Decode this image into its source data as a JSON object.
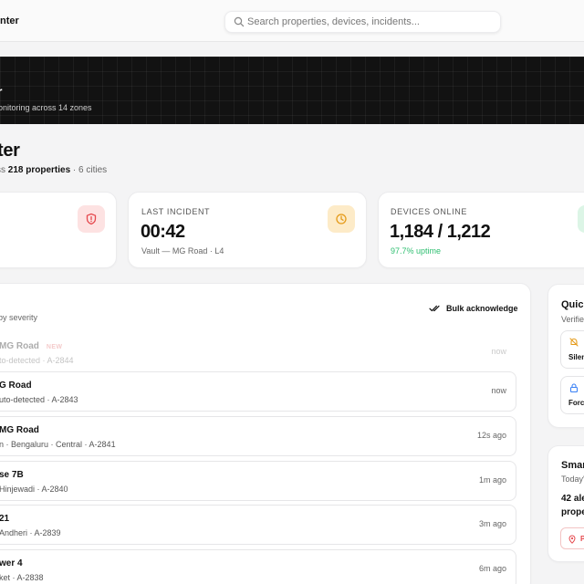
{
  "topbar": {
    "brand": "nter",
    "search_placeholder": "Search properties, devices, incidents..."
  },
  "hero": {
    "title": "r",
    "subtitle": "onitoring across 14 zones"
  },
  "page": {
    "title": "ter",
    "subtitle_prefix": "ss ",
    "subtitle_bold": "218 properties",
    "subtitle_suffix": " · 6 cities"
  },
  "stats": [
    {
      "label": "",
      "value": "",
      "foot": "",
      "icon": "shield-alert-icon",
      "accent": "#e5484d",
      "accent_bg": "#fde2e2"
    },
    {
      "label": "LAST INCIDENT",
      "value": "00:42",
      "foot": "Vault — MG Road · L4",
      "icon": "clock-icon",
      "accent": "#e59b1a",
      "accent_bg": "#fdebc8"
    },
    {
      "label": "DEVICES ONLINE",
      "value": "1,184 / 1,212",
      "foot": "97.7% uptime",
      "icon": "device-icon",
      "accent": "#2fbf71",
      "accent_bg": "#dcf5e6"
    }
  ],
  "incidents_panel": {
    "subtitle": "by severity",
    "bulk_label": "Bulk acknowledge",
    "new_badge": "NEW",
    "items": [
      {
        "title": "MG Road",
        "sub": "to-detected · A-2844",
        "time": "now",
        "is_new": true
      },
      {
        "title": "G Road",
        "sub": "uto-detected · A-2843",
        "time": "now"
      },
      {
        "title": "MG Road",
        "sub": "n · Bengaluru · Central · A-2841",
        "time": "12s ago"
      },
      {
        "title": "se 7B",
        "sub": "Hinjewadi · A-2840",
        "time": "1m ago"
      },
      {
        "title": "21",
        "sub": "Andheri · A-2839",
        "time": "3m ago"
      },
      {
        "title": "wer 4",
        "sub": "ket · A-2838",
        "time": "6m ago"
      }
    ]
  },
  "quick": {
    "title": "Quick",
    "subtitle": "Verifie",
    "buttons": [
      {
        "label": "Silen",
        "icon": "bell-off-icon",
        "color": "#e59b1a"
      },
      {
        "label": "Forc",
        "icon": "lock-icon",
        "color": "#3b82f6"
      }
    ]
  },
  "smart": {
    "title": "Smar",
    "subtitle": "Today'",
    "text_line1": "42 ale",
    "text_line2": "prope",
    "chip_label": "P",
    "chip_icon": "map-pin-icon",
    "chip_color": "#e5484d"
  }
}
